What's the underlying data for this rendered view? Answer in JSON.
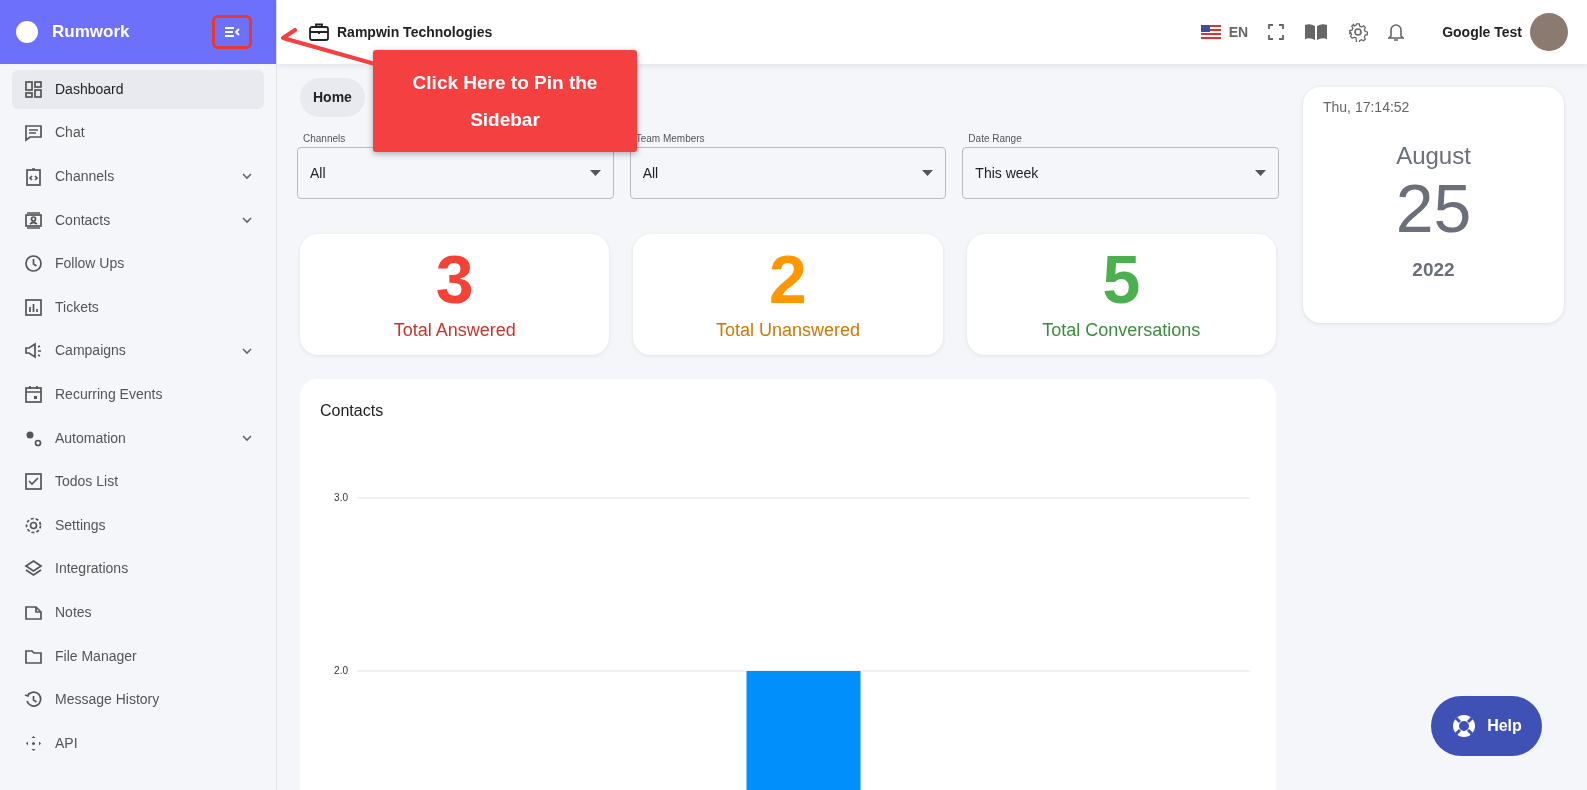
{
  "brand": {
    "name": "Rumwork"
  },
  "sidebar": {
    "items": [
      {
        "label": "Dashboard",
        "selected": true
      },
      {
        "label": "Chat",
        "selected": false
      },
      {
        "label": "Channels",
        "selected": false,
        "expanded": false
      },
      {
        "label": "Contacts",
        "selected": false,
        "expanded": false
      },
      {
        "label": "Follow Ups",
        "selected": false
      },
      {
        "label": "Tickets",
        "selected": false
      },
      {
        "label": "Campaigns",
        "selected": false,
        "expanded": false
      },
      {
        "label": "Recurring Events",
        "selected": false
      },
      {
        "label": "Automation",
        "selected": false,
        "expanded": false
      },
      {
        "label": "Todos List",
        "selected": false
      },
      {
        "label": "Settings",
        "selected": false
      },
      {
        "label": "Integrations",
        "selected": false
      },
      {
        "label": "Notes",
        "selected": false
      },
      {
        "label": "File Manager",
        "selected": false
      },
      {
        "label": "Message History",
        "selected": false
      },
      {
        "label": "API",
        "selected": false
      }
    ]
  },
  "header": {
    "company": "Rampwin Technologies",
    "language": "EN",
    "user": "Google Test"
  },
  "callout": {
    "text": "Click Here to Pin the Sidebar"
  },
  "breadcrumb": "Home",
  "filters": [
    {
      "label": "Channels",
      "value": "All"
    },
    {
      "label": "Team Members",
      "value": "All"
    },
    {
      "label": "Date Range",
      "value": "This week"
    }
  ],
  "stats": [
    {
      "value": "3",
      "label": "Total Answered",
      "color": "#f44336"
    },
    {
      "value": "2",
      "label": "Total Unanswered",
      "color": "#ff9800"
    },
    {
      "value": "5",
      "label": "Total Conversations",
      "color": "#4caf50"
    }
  ],
  "clock": {
    "time": "Thu, 17:14:52",
    "month": "August",
    "day": "25",
    "year": "2022"
  },
  "contacts_chart": {
    "title": "Contacts",
    "chart_data": {
      "type": "bar",
      "values": [
        2
      ],
      "ylim": [
        0,
        3
      ],
      "yticks": [
        {
          "value": 2,
          "label": "2.0"
        },
        {
          "value": 3,
          "label": "3.0"
        }
      ]
    }
  },
  "help_button": "Help"
}
